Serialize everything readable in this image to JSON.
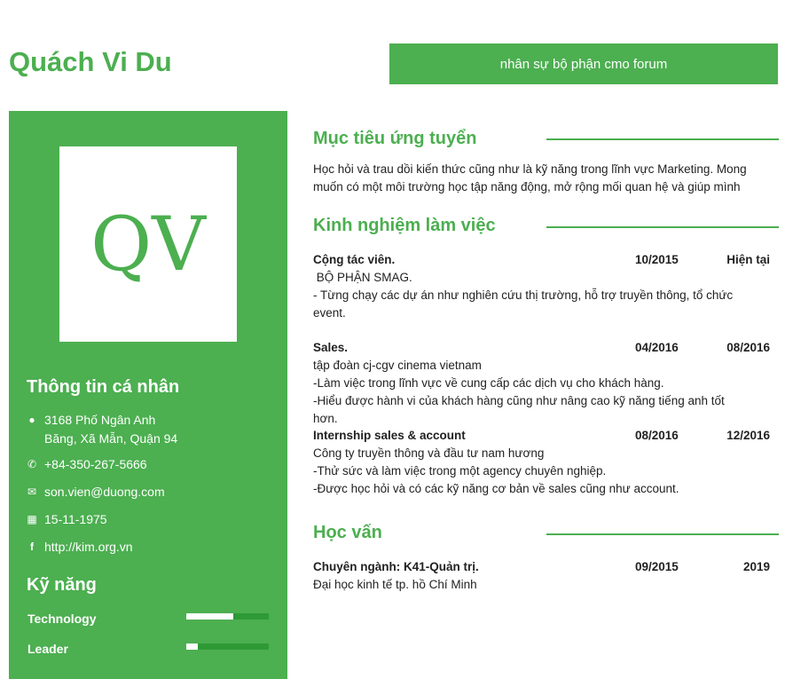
{
  "header": {
    "name": "Quách Vi Du",
    "role": "nhân sự bộ phận cmo forum"
  },
  "sidebar": {
    "initials": "QV",
    "personal_title": "Thông tin cá nhân",
    "info": [
      {
        "icon": "map-marker-icon",
        "lines": [
          "3168 Phố Ngân Anh",
          "Băng, Xã Mẫn, Quận 94"
        ]
      },
      {
        "icon": "phone-icon",
        "text": "+84-350-267-5666"
      },
      {
        "icon": "envelope-icon",
        "text": "son.vien@duong.com"
      },
      {
        "icon": "calendar-icon",
        "text": "15-11-1975"
      },
      {
        "icon": "facebook-icon",
        "text": "http://kim.org.vn"
      }
    ],
    "skills_title": "Kỹ năng",
    "skills": [
      {
        "name": "Technology",
        "level": 0.57
      },
      {
        "name": "Leader",
        "level": 0.14
      }
    ]
  },
  "main": {
    "objective_title": "Mục tiêu ứng tuyển",
    "objective": "Học hỏi và trau dồi kiến thức cũng như là kỹ năng trong lĩnh vực Marketing. Mong muốn có một môi trường học tập năng động, mở rộng mối quan hệ và giúp mình",
    "experience_title": "Kinh nghiệm làm việc",
    "jobs": [
      {
        "title": "Cộng tác viên.",
        "start": "10/2015",
        "end": "Hiện tại",
        "lines": [
          " BỘ PHẬN SMAG.",
          "- Từng chạy các dự án như nghiên cứu thị trường, hỗ trợ truyền thông, tổ chức event."
        ]
      },
      {
        "title": "Sales.",
        "start": "04/2016",
        "end": "08/2016",
        "lines": [
          "tập đoàn cj-cgv cinema vietnam",
          "-Làm việc trong lĩnh vực về cung cấp các dịch vụ cho khách hàng.",
          "-Hiểu được hành vi của khách hàng cũng như nâng cao kỹ năng tiếng anh tốt hơn."
        ]
      },
      {
        "title": "Internship sales & account",
        "start": "08/2016",
        "end": "12/2016",
        "lines": [
          "Công ty truyền thông và đầu tư nam hương",
          "-Thử sức và làm việc trong một agency chuyên nghiệp.",
          "-Được học hỏi và có các kỹ năng cơ bản về sales cũng như account."
        ]
      }
    ],
    "education_title": "Học vấn",
    "education": [
      {
        "title": "Chuyên ngành: K41-Quản trị.",
        "start": "09/2015",
        "end": "2019",
        "lines": [
          "Đại học kinh tế tp. hồ Chí Minh"
        ]
      }
    ]
  },
  "colors": {
    "accent": "#4caf50"
  }
}
